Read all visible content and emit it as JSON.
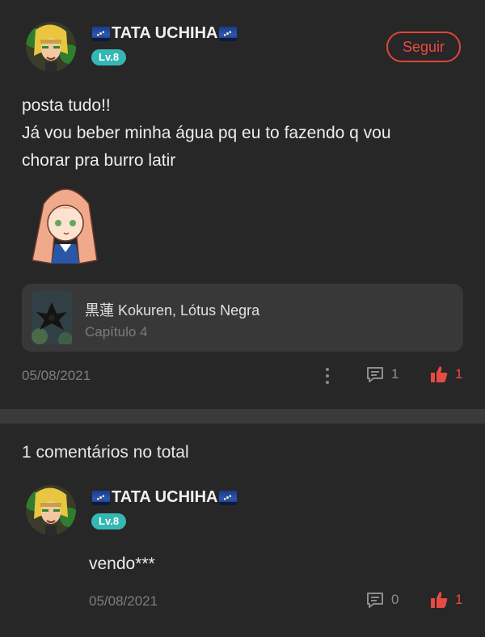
{
  "post": {
    "author": "TATA UCHIHA",
    "level": "Lv.8",
    "follow_label": "Seguir",
    "text_line1": "posta tudo!!",
    "text_line2": "Já vou beber minha água pq eu to fazendo q vou",
    "text_line3": "chorar pra burro latir",
    "book": {
      "title": "黒蓮 Kokuren, Lótus Negra",
      "chapter": "Capítulo 4"
    },
    "date": "05/08/2021",
    "comment_count": "1",
    "like_count": "1"
  },
  "comments_section": {
    "total_label": "1 comentários no total"
  },
  "comment": {
    "author": "TATA UCHIHA",
    "level": "Lv.8",
    "text": "vendo***",
    "date": "05/08/2021",
    "reply_count": "0",
    "like_count": "1"
  },
  "colors": {
    "background": "#272727",
    "accent_red": "#e84b43",
    "level_teal": "#36b7b4",
    "card": "#383838"
  }
}
